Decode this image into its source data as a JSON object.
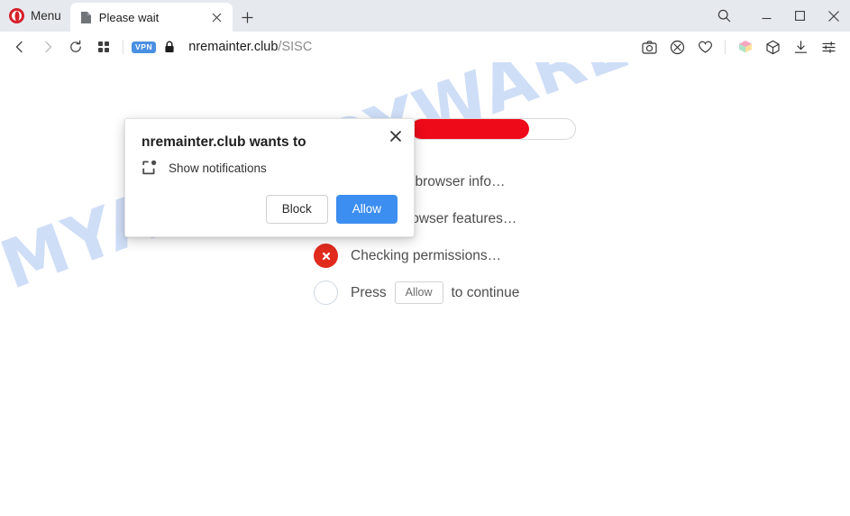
{
  "browser": {
    "menu_label": "Menu",
    "tab": {
      "title": "Please wait",
      "favicon_icon": "page-icon",
      "close_icon": "close-icon"
    },
    "newtab_icon": "plus-icon",
    "window_controls": {
      "search_icon": "search-icon",
      "minimize_icon": "minimize-icon",
      "maximize_icon": "maximize-icon",
      "close_icon": "close-icon"
    },
    "nav": {
      "back_icon": "back-arrow-icon",
      "forward_icon": "forward-arrow-icon",
      "reload_icon": "reload-icon",
      "tiles_icon": "grid-tiles-icon"
    },
    "address": {
      "vpn_badge": "VPN",
      "lock_icon": "lock-icon",
      "host": "nremainter.club",
      "path": "/SISC"
    },
    "toolbar_icons": [
      "camera-snapshot-icon",
      "ad-blocker-icon",
      "heart-favorite-icon",
      "workspaces-cube-icon",
      "extensions-cube-icon",
      "download-icon",
      "easy-setup-sliders-icon"
    ]
  },
  "dialog": {
    "title": "nremainter.club wants to",
    "permission_icon": "notification-popup-icon",
    "permission_label": "Show notifications",
    "block_label": "Block",
    "allow_label": "Allow",
    "close_icon": "close-icon"
  },
  "page": {
    "watermark": "MYANTISPYWARE.COM",
    "progress": {
      "percent": 72,
      "fill_color": "#ef0a19"
    },
    "steps": [
      {
        "state": "ok",
        "icon": "check-icon",
        "text": "Analyzing browser info…"
      },
      {
        "state": "ok",
        "icon": "check-icon",
        "text": "Testing browser features…"
      },
      {
        "state": "fail",
        "icon": "cross-icon",
        "text": "Checking permissions…"
      },
      {
        "state": "pending",
        "icon": "circle-icon",
        "text_before": "Press",
        "chip": "Allow",
        "text_after": "to continue"
      }
    ]
  }
}
